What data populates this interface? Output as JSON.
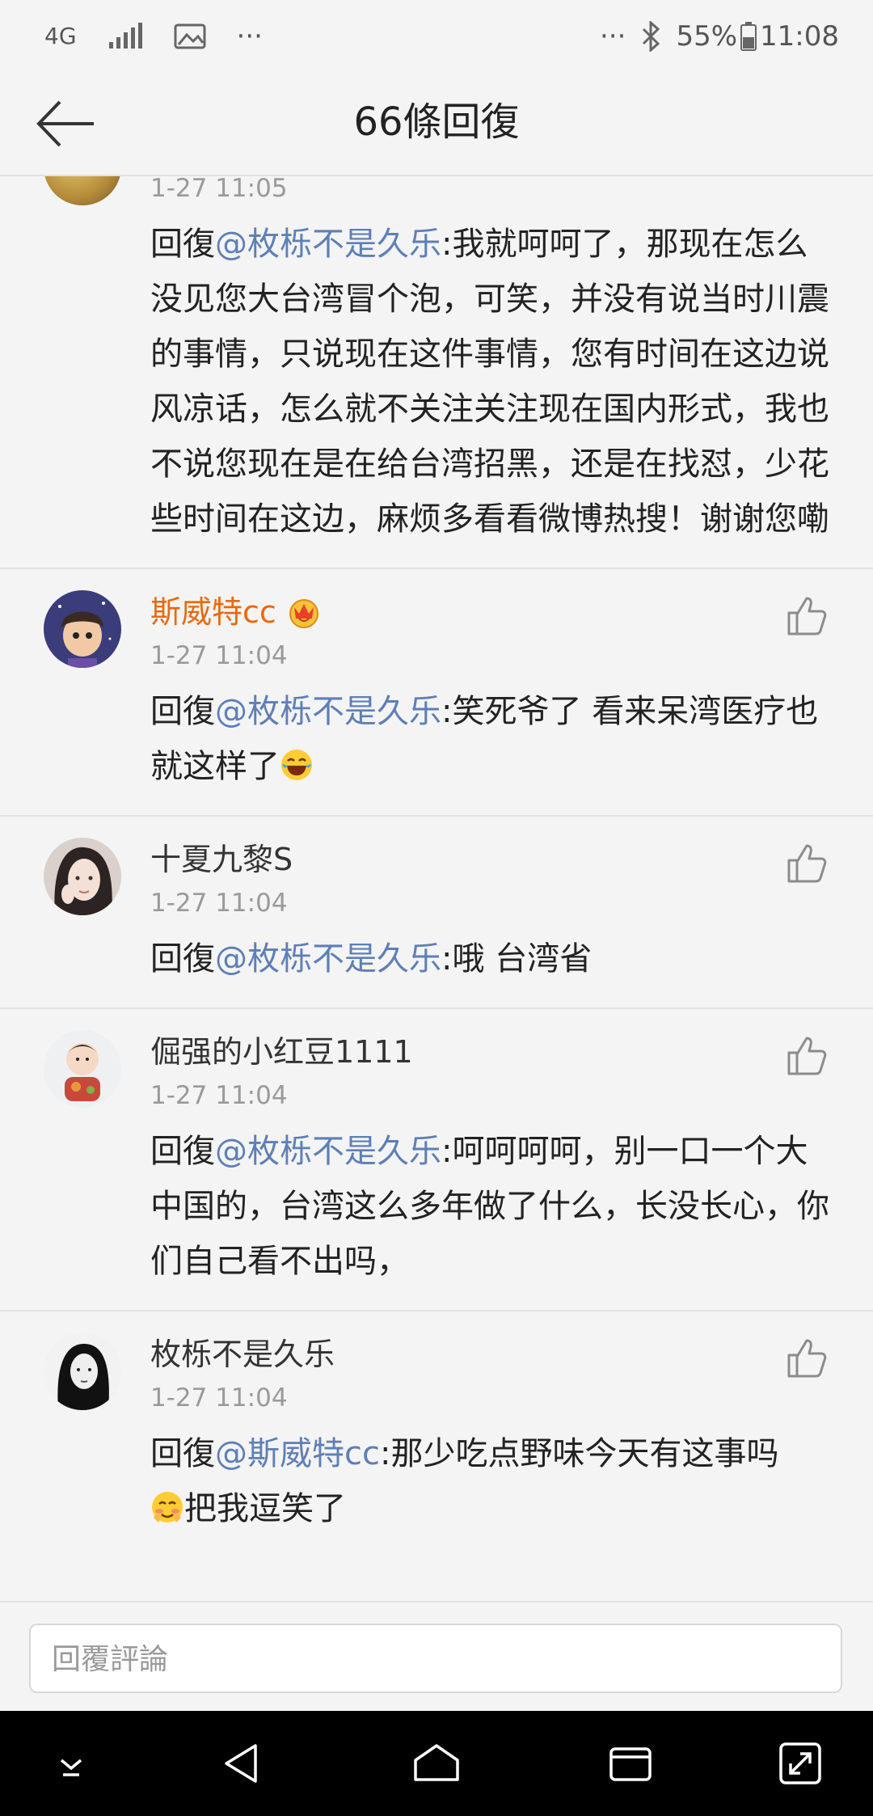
{
  "status_bar": {
    "network": "4G",
    "battery": "55%",
    "time": "11:08",
    "dots": "···"
  },
  "header": {
    "title": "66條回復"
  },
  "comments": [
    {
      "username": "",
      "timestamp": "1-27 11:05",
      "reply_prefix": "回復",
      "mention": "@枚栎不是久乐",
      "text": ":我就呵呵了，那现在怎么没见您大台湾冒个泡，可笑，并没有说当时川震的事情，只说现在这件事情，您有时间在这边说风凉话，怎么就不关注关注现在国内形式，我也不说您现在是在给台湾招黑，还是在找怼，少花些时间在这边，麻烦多看看微博热搜！谢谢您嘞"
    },
    {
      "username": "斯威特cc",
      "timestamp": "1-27 11:04",
      "reply_prefix": "回復",
      "mention": "@枚栎不是久乐",
      "text": ":笑死爷了 看来呆湾医疗也就这样了"
    },
    {
      "username": "十夏九黎S",
      "timestamp": "1-27 11:04",
      "reply_prefix": "回復",
      "mention": "@枚栎不是久乐",
      "text": ":哦 台湾省"
    },
    {
      "username": "倔强的小红豆1111",
      "timestamp": "1-27 11:04",
      "reply_prefix": "回復",
      "mention": "@枚栎不是久乐",
      "text": ":呵呵呵呵，别一口一个大中国的，台湾这么多年做了什么，长没长心，你们自己看不出吗，"
    },
    {
      "username": "枚栎不是久乐",
      "timestamp": "1-27 11:04",
      "reply_prefix": "回復",
      "mention": "@斯威特cc",
      "text": ":那少吃点野味今天有这事吗",
      "text_after_emoji": "把我逗笑了"
    }
  ],
  "reply_bar": {
    "placeholder": "回覆評論"
  },
  "icons": {
    "back": "arrow-left-icon",
    "like": "thumbs-up-icon",
    "vip_badge": "crown-badge-icon",
    "emoji_laugh": "laughing-tears-emoji",
    "emoji_blush": "blushing-smile-emoji"
  },
  "colors": {
    "background": "#f4f4f4",
    "mention": "#5e7fb6",
    "vip_name": "#e8690f",
    "timestamp": "#9a9a9a",
    "navbar": "#000000"
  }
}
